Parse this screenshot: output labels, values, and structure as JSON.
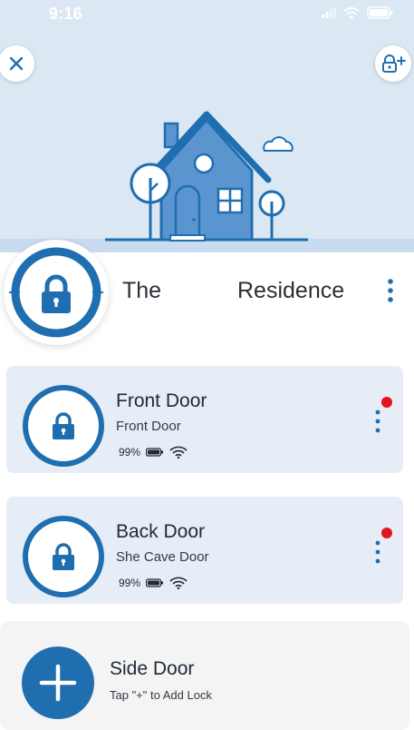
{
  "status_bar": {
    "time": "9:16"
  },
  "header": {
    "close_icon": "close-icon",
    "add_lock_icon": "lock-plus-icon"
  },
  "home": {
    "name_part1": "The",
    "name_part2": "Residence"
  },
  "locks": [
    {
      "name": "Front Door",
      "subtitle": "Front Door",
      "battery": "99%",
      "has_alert": true
    },
    {
      "name": "Back Door",
      "subtitle": "She Cave Door",
      "battery": "99%",
      "has_alert": true
    }
  ],
  "add_lock": {
    "name": "Side Door",
    "hint": "Tap \"+\" to Add Lock"
  },
  "colors": {
    "brand_blue": "#1f6fb0",
    "alert_red": "#e3141b",
    "hero_bg": "#dce7f4",
    "card_bg": "#e6edf7"
  }
}
